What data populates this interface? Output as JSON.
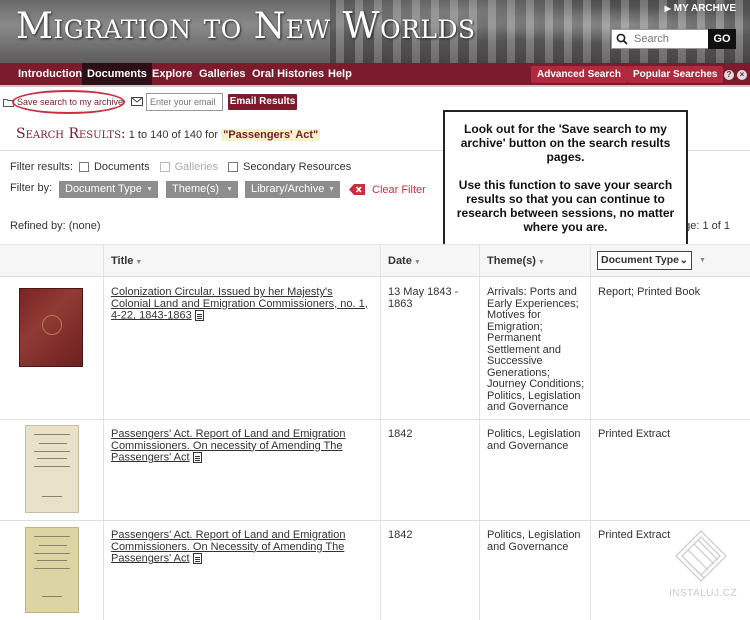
{
  "header": {
    "site_title": "Migration to New Worlds",
    "my_archive": "MY ARCHIVE",
    "search_placeholder": "Search",
    "go_label": "GO"
  },
  "nav": {
    "items": [
      "Introduction",
      "Documents",
      "Explore",
      "Galleries",
      "Oral Histories",
      "Help"
    ],
    "active": "Documents",
    "advanced_search": "Advanced Search",
    "popular_searches": "Popular Searches"
  },
  "toolbar": {
    "save_search": "Save search to my archive",
    "email_placeholder": "Enter your email",
    "email_results": "Email Results"
  },
  "results": {
    "heading_label": "Search Results:",
    "count_text": "1 to 140 of 140 for",
    "query": "\"Passengers' Act\""
  },
  "filters": {
    "filter_results_label": "Filter results:",
    "options": [
      {
        "label": "Documents",
        "enabled": true
      },
      {
        "label": "Galleries",
        "enabled": false
      },
      {
        "label": "Secondary Resources",
        "enabled": true
      }
    ],
    "filter_by_label": "Filter by:",
    "dropdowns": [
      "Document Type",
      "Theme(s)",
      "Library/Archive"
    ],
    "clear_filter": "Clear Filter",
    "refined_by": "Refined by: (none)",
    "page_of": "age: 1 of 1"
  },
  "tooltip": {
    "para1": "Look out for the 'Save search to my archive' button on the search results pages.",
    "para2": "Use this function to save your search results so that you can continue to research between sessions, no matter where you are."
  },
  "table": {
    "headers": {
      "title": "Title",
      "date": "Date",
      "themes": "Theme(s)",
      "doc_type": "Document Type"
    },
    "rows": [
      {
        "title": "Colonization Circular. Issued by her Majesty's Colonial Land and Emigration Commissioners, no. 1, 4-22, 1843-1863",
        "date": "13 May 1843 - 1863",
        "themes": "Arrivals: Ports and Early Experiences; Motives for Emigration; Permanent Settlement and Successive Generations; Journey Conditions; Politics, Legislation and Governance",
        "doc_type": "Report; Printed Book"
      },
      {
        "title": "Passengers' Act. Report of Land and Emigration Commissioners. On necessity of Amending The Passengers' Act",
        "date": "1842",
        "themes": "Politics, Legislation and Governance",
        "doc_type": "Printed Extract"
      },
      {
        "title": "Passengers' Act. Report of Land and Emigration Commissioners. On Necessity of Amending The Passengers' Act",
        "date": "1842",
        "themes": "Politics, Legislation and Governance",
        "doc_type": "Printed Extract"
      }
    ]
  },
  "watermark": "INSTALUJ.CZ"
}
